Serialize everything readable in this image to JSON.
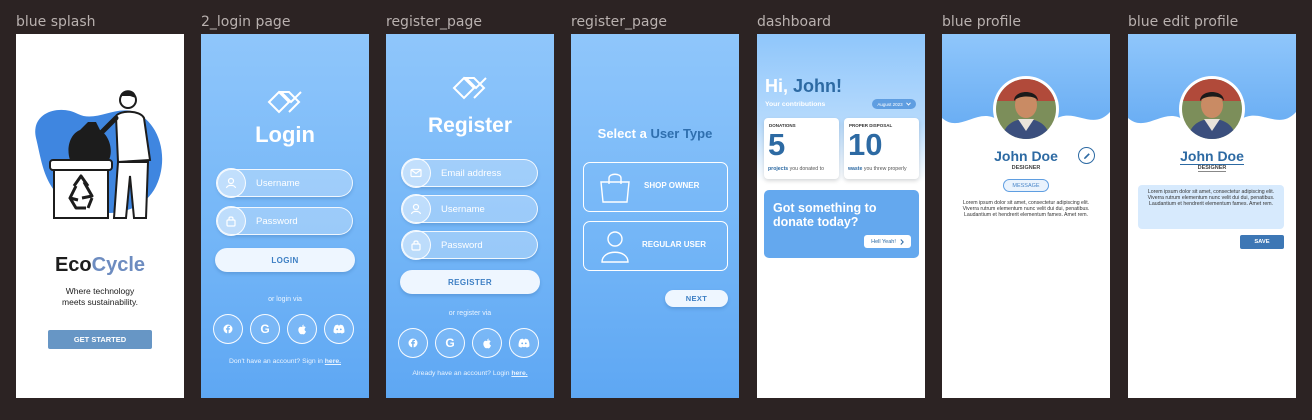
{
  "frames": {
    "splash": {
      "label": "blue splash",
      "brand_a": "Eco",
      "brand_b": "Cycle",
      "tagline": "Where technology meets sustainability.",
      "cta": "GET STARTED"
    },
    "login": {
      "label": "2_login page",
      "title": "Login",
      "username_ph": "Username",
      "password_ph": "Password",
      "login_btn": "LOGIN",
      "or_via": "or login via",
      "footer_text": "Don't have an account? Sign in",
      "footer_link": "here."
    },
    "register": {
      "label": "register_page",
      "title": "Register",
      "email_ph": "Email address",
      "username_ph": "Username",
      "password_ph": "Password",
      "register_btn": "REGISTER",
      "or_via": "or register via",
      "footer_text": "Already have an account? Login",
      "footer_link": "here."
    },
    "usertype": {
      "label": "register_page",
      "title_a": "Select a",
      "title_b": "User Type",
      "shop_owner": "SHOP OWNER",
      "regular_user": "REGULAR USER",
      "next": "NEXT"
    },
    "dashboard": {
      "label": "dashboard",
      "hi": "Hi,",
      "name": "John!",
      "contrib": "Your contributions",
      "month": "August 2023",
      "donations_label": "DONATIONS",
      "donations_value": "5",
      "donations_word": "projects",
      "donations_rest": "you donated to",
      "disposal_label": "PROPER DISPOSAL",
      "disposal_value": "10",
      "disposal_word": "waste",
      "disposal_rest": "you threw properly",
      "donate_line1": "Got something to",
      "donate_line2": "donate today?",
      "donate_btn": "Hell Yeah!"
    },
    "profile": {
      "label": "blue profile",
      "name": "John Doe",
      "role": "DESIGNER",
      "message_btn": "MESSAGE",
      "bio": "Lorem ipsum dolor sit amet, consectetur adipiscing elit. Viverra rutrum elementum nunc velit dui dui, penatibus. Laudantium et hendrerit elementum fames. Amet rem."
    },
    "edit": {
      "label": "blue edit profile",
      "name": "John Doe",
      "role": "DESIGNER",
      "bio": "Lorem ipsum dolor sit amet, consectetur adipiscing elit. Viverra rutrum elementum nunc velit dui dui, penatibus. Laudantium et hendrerit elementum fames. Amet rem.",
      "save_btn": "SAVE"
    }
  },
  "colors": {
    "background": "#2c2323",
    "blue_light": "#8fc6fb",
    "blue_dark": "#2d6aa3",
    "accent_btn": "#6796c5"
  },
  "icons": [
    "recycle-icon",
    "user-icon",
    "lock-icon",
    "mail-icon",
    "facebook-icon",
    "google-icon",
    "apple-icon",
    "discord-icon",
    "shopping-bag-icon",
    "chevron-down-icon",
    "chevron-right-icon",
    "edit-pencil-icon"
  ]
}
